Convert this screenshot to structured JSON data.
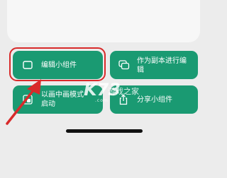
{
  "menu": {
    "edit_widget": "编辑小组件",
    "copy_to_edit": "作为副本进行编辑",
    "picture_in_picture": "以画中画模式启动",
    "share_widget": "分享小组件"
  },
  "watermark": {
    "logo_text": "K73",
    "site_name": "游戏之家",
    "domain": ".com"
  },
  "colors": {
    "button_bg": "#1a9a72",
    "highlight": "#d82a2a",
    "background": "#ececec"
  },
  "icons": [
    "widget-outline-icon",
    "duplicate-icon",
    "picture-in-picture-icon",
    "share-icon"
  ]
}
